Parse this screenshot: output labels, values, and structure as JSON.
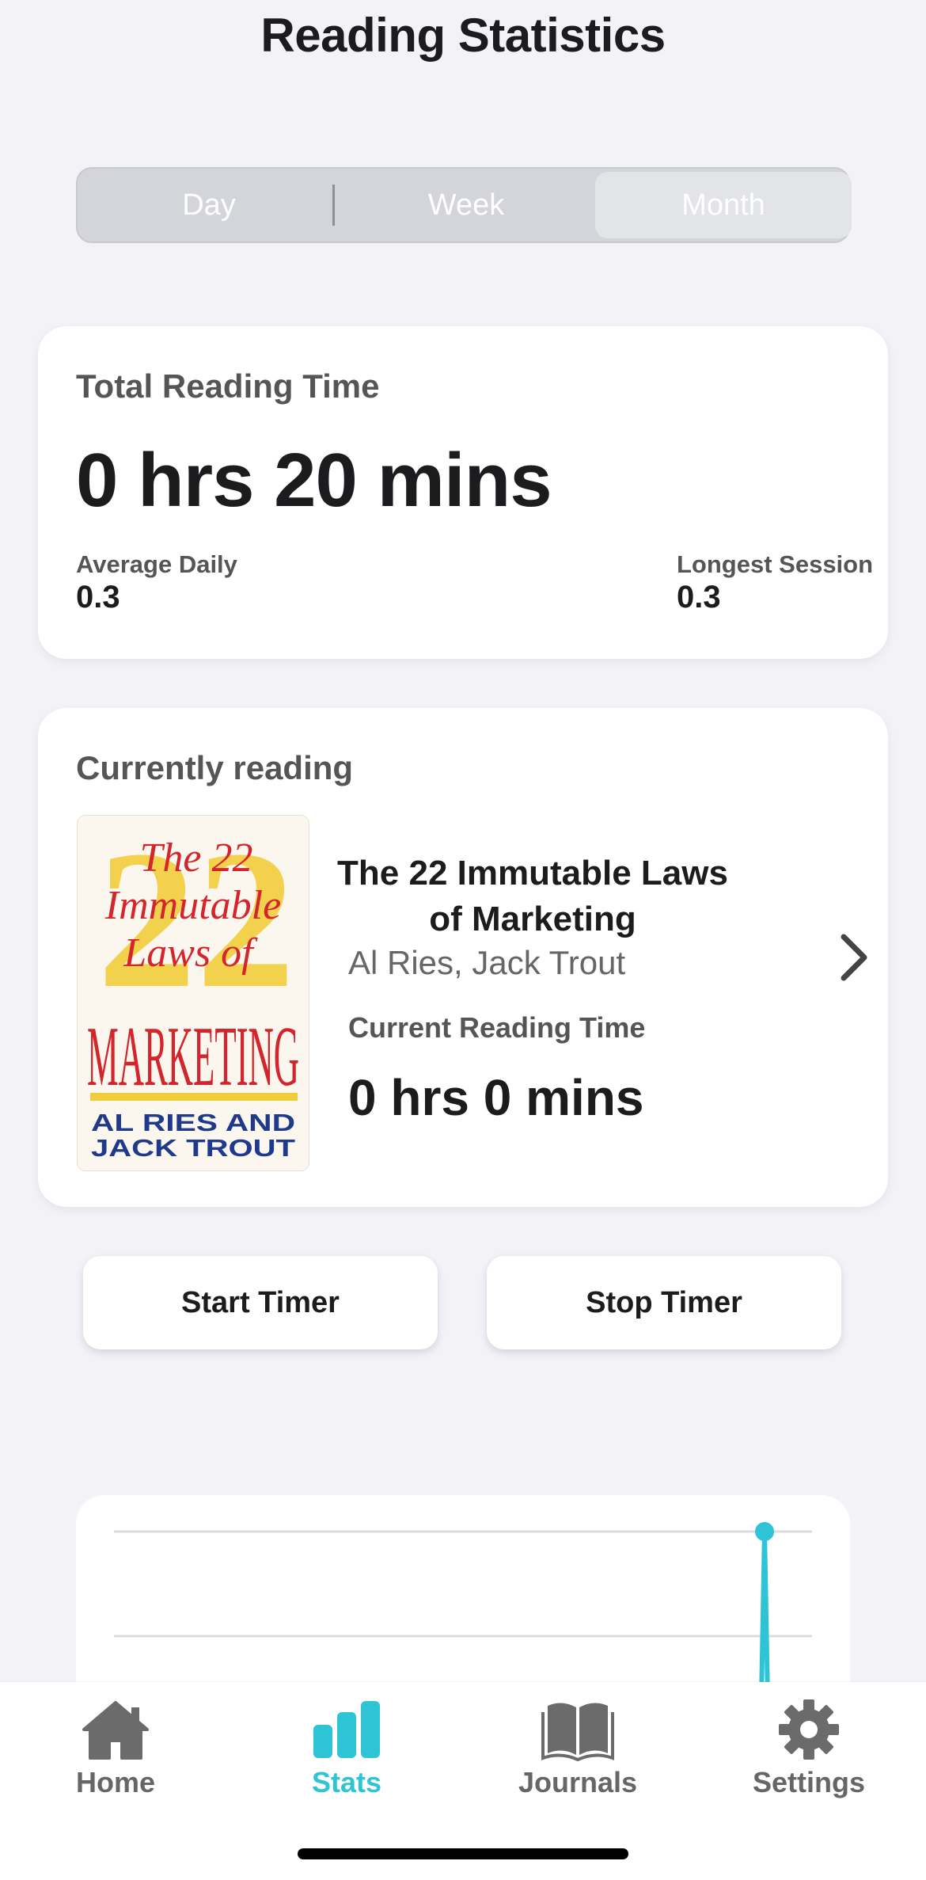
{
  "header": {
    "title": "Reading Statistics"
  },
  "segments": {
    "items": [
      "Day",
      "Week",
      "Month"
    ],
    "selected": "Month"
  },
  "total_card": {
    "label": "Total Reading Time",
    "value": "0 hrs 20 mins",
    "average_daily_label": "Average Daily",
    "average_daily_value": "0.3",
    "longest_session_label": "Longest Session",
    "longest_session_value": "0.3"
  },
  "current_card": {
    "label": "Currently reading",
    "cover": {
      "line1": "The 22",
      "line2": "Immutable",
      "line3": "Laws of",
      "big_number": "22",
      "marketing": "MARKETING",
      "authors_line1": "AL RIES AND",
      "authors_line2": "JACK TROUT"
    },
    "book_title": "The 22 Immutable Laws of Marketing",
    "book_author": "Al Ries, Jack Trout",
    "current_time_label": "Current Reading Time",
    "current_time_value": "0 hrs 0 mins"
  },
  "buttons": {
    "start": "Start Timer",
    "stop": "Stop Timer"
  },
  "chart_data": {
    "type": "line",
    "series": [
      {
        "values": [
          0,
          0,
          0,
          0,
          0,
          0,
          1
        ]
      }
    ],
    "grid": true,
    "color": "#2ec4d6"
  },
  "tabbar": {
    "items": [
      {
        "label": "Home",
        "icon": "house-icon"
      },
      {
        "label": "Stats",
        "icon": "bar-chart-icon"
      },
      {
        "label": "Journals",
        "icon": "book-open-icon"
      },
      {
        "label": "Settings",
        "icon": "gear-icon"
      }
    ],
    "active": "Stats",
    "active_color": "#2ec4d6",
    "inactive_color": "#666666"
  }
}
